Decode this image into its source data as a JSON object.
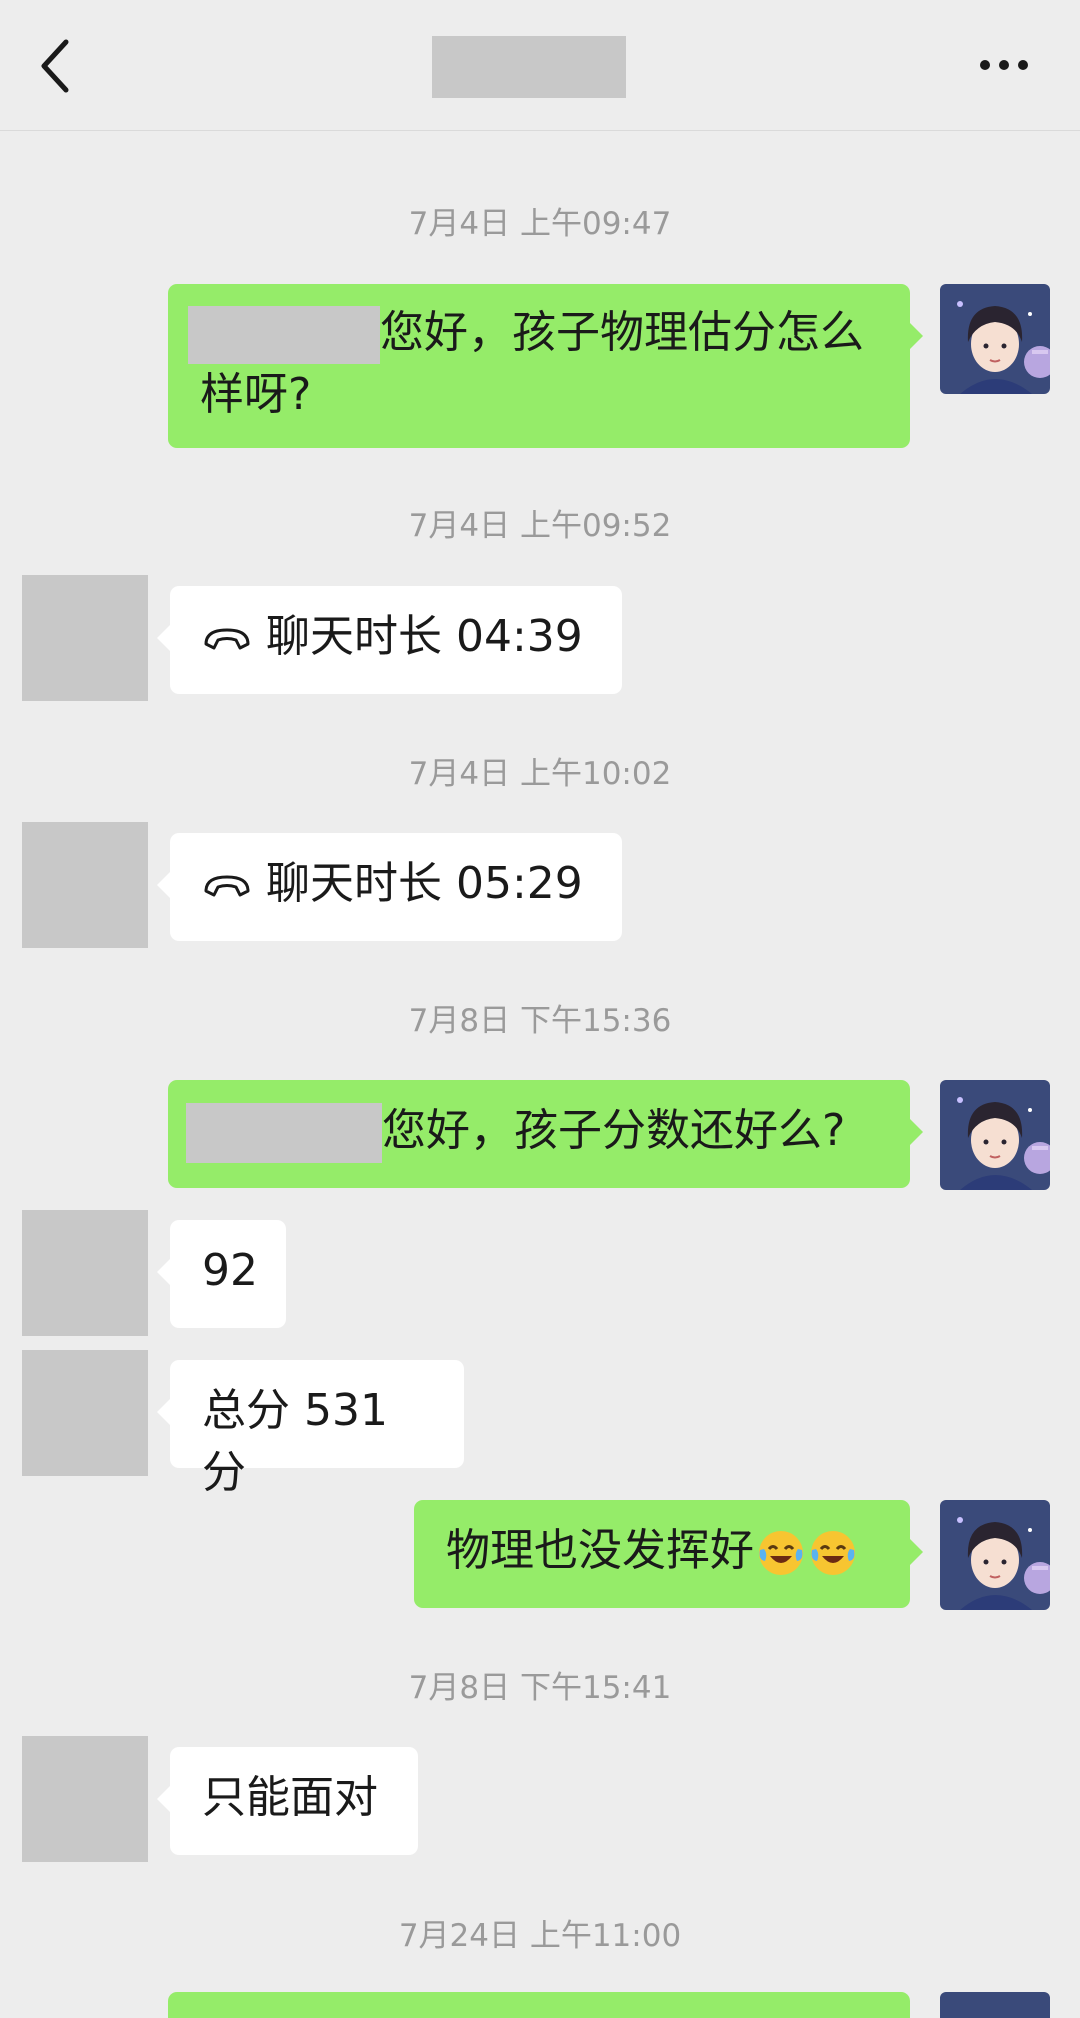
{
  "header": {
    "back_icon": "chevron-left-icon",
    "more_icon": "ellipsis-icon"
  },
  "colors": {
    "background": "#ededed",
    "sent_bubble": "#95ec69",
    "received_bubble": "#ffffff",
    "timestamp": "#9a9a9a",
    "redaction": "#c8c8c8"
  },
  "messages": [
    {
      "type": "timestamp",
      "text": "7月4日 上午09:47"
    },
    {
      "type": "sent",
      "text_line1": "您好，孩子物理估分怎么",
      "text_line2": "样呀?"
    },
    {
      "type": "timestamp",
      "text": "7月4日 上午09:52"
    },
    {
      "type": "received-call",
      "text": "聊天时长 04:39",
      "icon": "phone-hangup-icon"
    },
    {
      "type": "timestamp",
      "text": "7月4日 上午10:02"
    },
    {
      "type": "received-call",
      "text": "聊天时长 05:29",
      "icon": "phone-hangup-icon"
    },
    {
      "type": "timestamp",
      "text": "7月8日 下午15:36"
    },
    {
      "type": "sent",
      "text": "您好，孩子分数还好么?"
    },
    {
      "type": "received",
      "text": "92"
    },
    {
      "type": "received",
      "text": "总分 531 分"
    },
    {
      "type": "sent",
      "text": "物理也没发挥好",
      "emoji": "face-with-tears-of-joy-icon"
    },
    {
      "type": "timestamp",
      "text": "7月8日 下午15:41"
    },
    {
      "type": "received",
      "text": "只能面对"
    },
    {
      "type": "timestamp",
      "text": "7月24日 上午11:00"
    }
  ]
}
